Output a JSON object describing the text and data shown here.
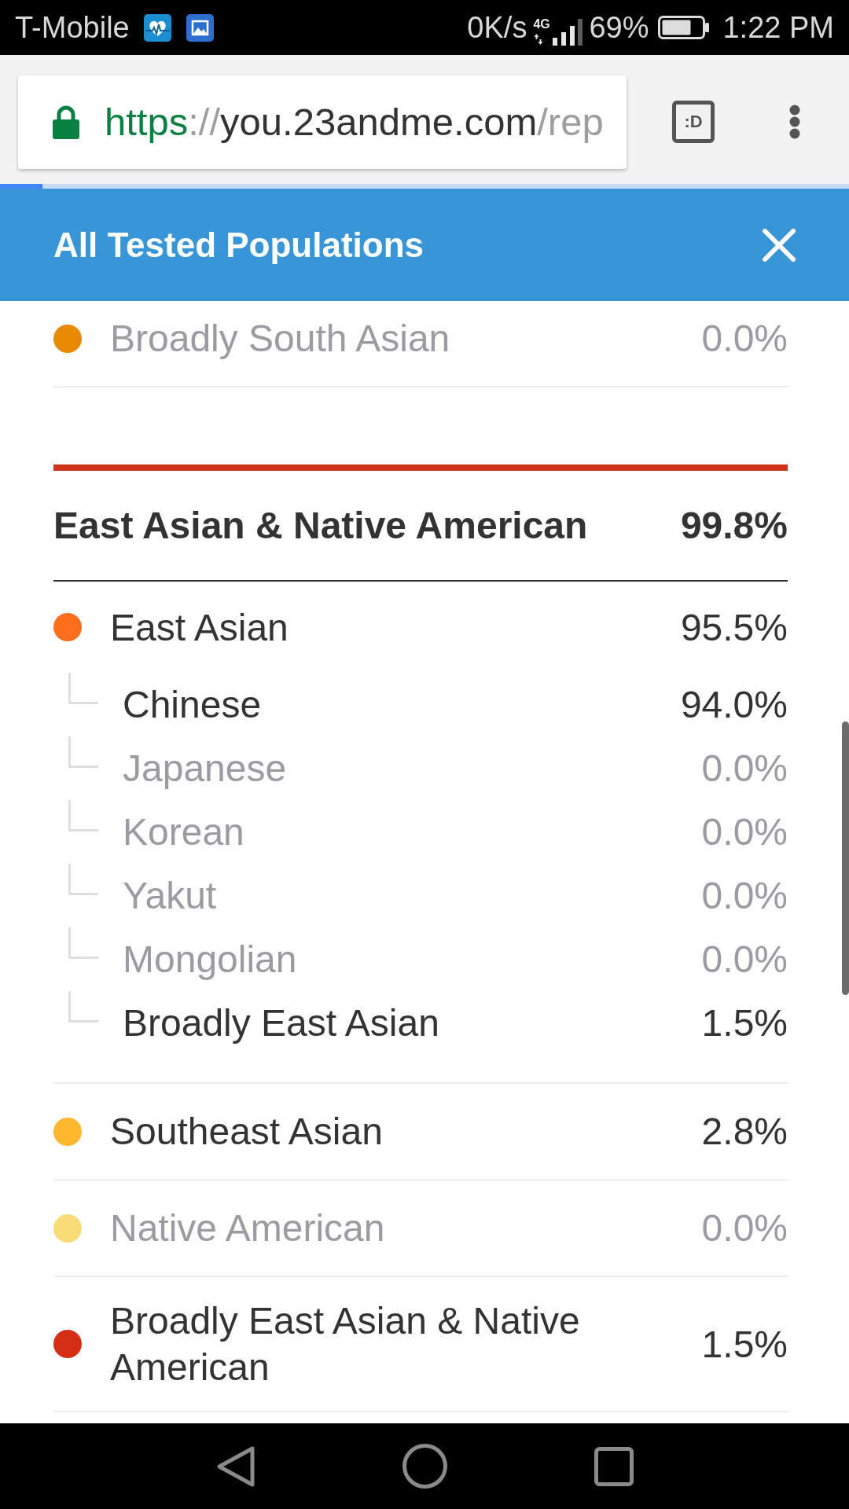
{
  "status_bar": {
    "carrier": "T-Mobile",
    "speed": "0K/s",
    "network": "4G",
    "battery": "69%",
    "time": "1:22 PM"
  },
  "browser": {
    "url": {
      "scheme": "https",
      "separator": "://",
      "host": "you.23andme.com",
      "path": "/rep"
    },
    "tab_switcher": ":D",
    "load_progress": {
      "level": 0.05
    }
  },
  "header": {
    "title": "All Tested Populations"
  },
  "groups": [
    {
      "items": [
        {
          "name": "Broadly South Asian",
          "value": "0.0%",
          "color": "#e88a00",
          "greyed": true
        }
      ]
    },
    {
      "title": "East Asian & Native American",
      "value": "99.8%",
      "color": "#d0301a",
      "items": [
        {
          "name": "East Asian",
          "value": "95.5%",
          "color": "#ff6e1c",
          "greyed": false,
          "children": [
            {
              "name": "Chinese",
              "value": "94.0%",
              "greyed": false
            },
            {
              "name": "Japanese",
              "value": "0.0%",
              "greyed": true
            },
            {
              "name": "Korean",
              "value": "0.0%",
              "greyed": true
            },
            {
              "name": "Yakut",
              "value": "0.0%",
              "greyed": true
            },
            {
              "name": "Mongolian",
              "value": "0.0%",
              "greyed": true
            },
            {
              "name": "Broadly East Asian",
              "value": "1.5%",
              "greyed": false
            }
          ]
        },
        {
          "name": "Southeast Asian",
          "value": "2.8%",
          "color": "#ffb82e",
          "greyed": false
        },
        {
          "name": "Native American",
          "value": "0.0%",
          "color": "#f9dc78",
          "greyed": true
        },
        {
          "name": "Broadly East Asian & Native American",
          "value": "1.5%",
          "color": "#d42f14",
          "greyed": false
        }
      ]
    }
  ]
}
